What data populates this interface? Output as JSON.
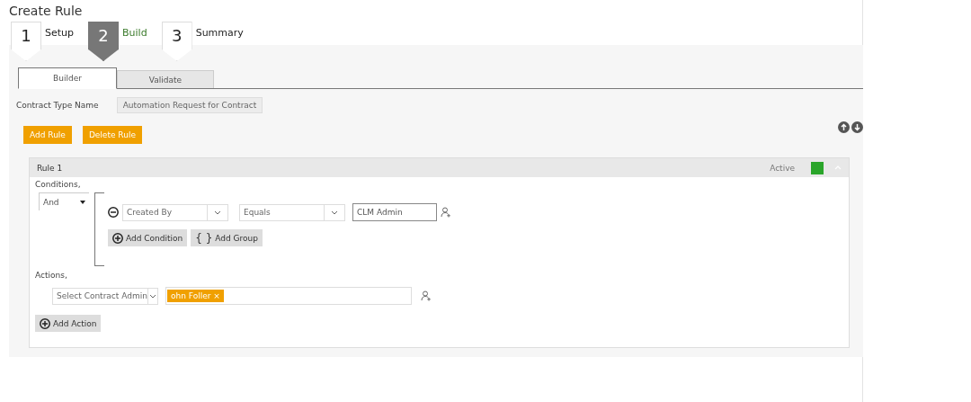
{
  "title": "Create Rule",
  "steps": [
    {
      "number": "1",
      "label": "Setup",
      "selected": false
    },
    {
      "number": "2",
      "label": "Build",
      "selected": true
    },
    {
      "number": "3",
      "label": "Summary",
      "selected": false
    }
  ],
  "tabs": [
    {
      "label": "Builder",
      "selected": true
    },
    {
      "label": "Validate",
      "selected": false
    }
  ],
  "contract_type": {
    "label": "Contract Type Name",
    "value": "Automation Request for Contract"
  },
  "buttons": [
    "Add Rule",
    "Delete Rule"
  ],
  "rule": {
    "title": "Rule 1",
    "status": "Active",
    "active": true,
    "expanded": true,
    "conditions_label": "Conditions,",
    "operator": "And",
    "conditions": [
      {
        "field": "Created By",
        "comparison": "Equals",
        "value": "CLM Admin"
      }
    ],
    "add_condition": "Add Condition",
    "group_icon": "{ }",
    "add_group": "Add Group",
    "actions_label": "Actions,",
    "action_select": "Select Contract Admin",
    "tokens": [
      {
        "label": "ohn Foller",
        "remove": "×"
      }
    ],
    "add_action": "Add Action"
  }
}
